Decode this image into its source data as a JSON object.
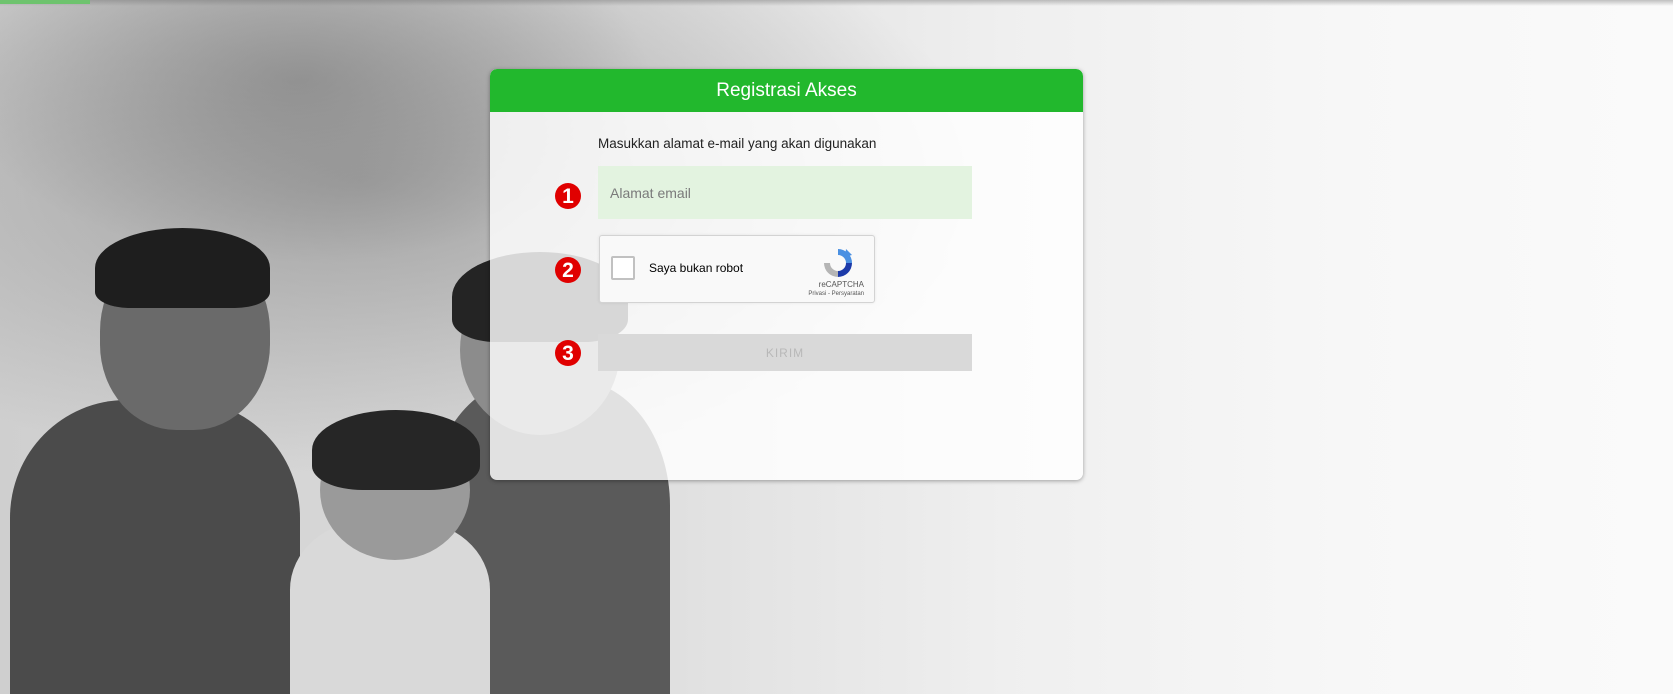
{
  "card": {
    "title": "Registrasi Akses",
    "instruction": "Masukkan alamat e-mail yang akan digunakan"
  },
  "form": {
    "email_placeholder": "Alamat email",
    "email_value": "",
    "submit_label": "KIRIM"
  },
  "recaptcha": {
    "label": "Saya bukan robot",
    "brand": "reCAPTCHA",
    "links": "Privasi - Persyaratan",
    "checked": false
  },
  "steps": {
    "one": "1",
    "two": "2",
    "three": "3"
  },
  "colors": {
    "header_green": "#22b82d",
    "input_bg": "#e3f3e0",
    "badge_red": "#e00000",
    "button_disabled": "#d9d9d9"
  },
  "icons": {
    "recaptcha": "recaptcha-logo-icon"
  }
}
